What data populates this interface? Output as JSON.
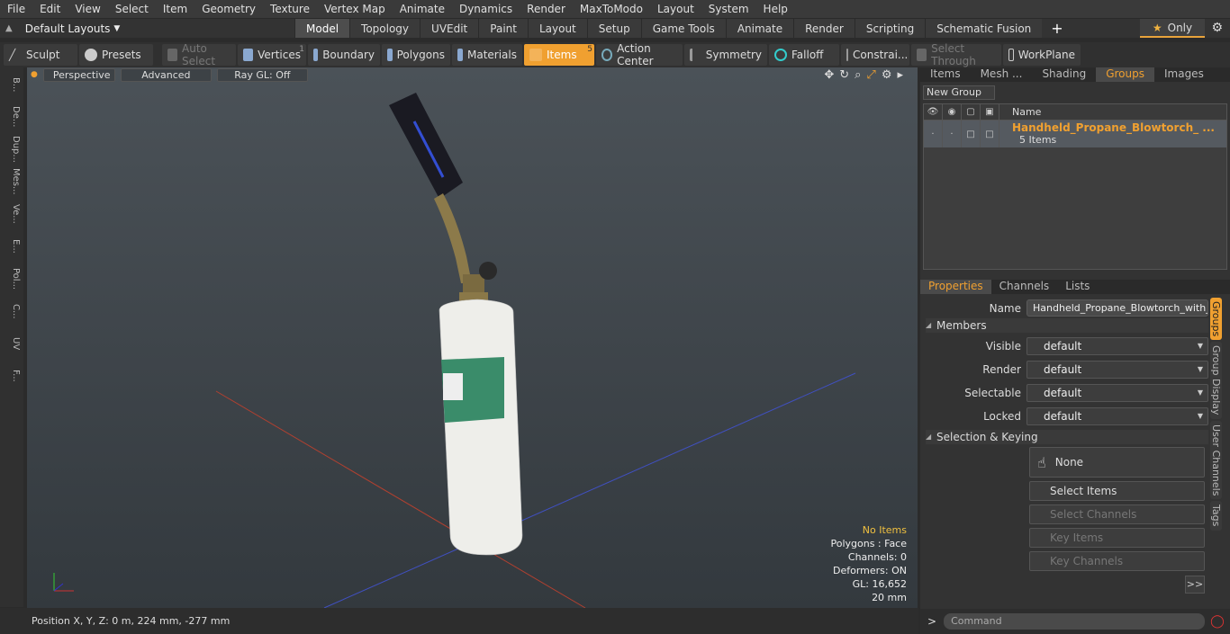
{
  "menu": [
    "File",
    "Edit",
    "View",
    "Select",
    "Item",
    "Geometry",
    "Texture",
    "Vertex Map",
    "Animate",
    "Dynamics",
    "Render",
    "MaxToModo",
    "Layout",
    "System",
    "Help"
  ],
  "layouts": {
    "label": "Default Layouts"
  },
  "modes": [
    "Model",
    "Topology",
    "UVEdit",
    "Paint",
    "Layout",
    "Setup",
    "Game Tools",
    "Animate",
    "Render",
    "Scripting",
    "Schematic Fusion"
  ],
  "only_label": "Only",
  "toolbar": {
    "sculpt": "Sculpt",
    "presets": "Presets",
    "auto_select": "Auto Select",
    "vertices": "Vertices",
    "vertices_count": "1",
    "boundary": "Boundary",
    "polygons": "Polygons",
    "materials": "Materials",
    "items": "Items",
    "items_count": "5",
    "action_center": "Action Center",
    "symmetry": "Symmetry",
    "falloff": "Falloff",
    "constraints": "Constrai...",
    "select_through": "Select Through",
    "workplane": "WorkPlane"
  },
  "left_tabs": [
    "B...",
    "De...",
    "Dup...",
    "Mes...",
    "Ve...",
    "E...",
    "Pol...",
    "C...",
    "UV",
    "F..."
  ],
  "viewport": {
    "perspective": "Perspective",
    "advanced": "Advanced",
    "raygl": "Ray GL: Off",
    "stats": {
      "items": "No Items",
      "polygons": "Polygons : Face",
      "channels": "Channels: 0",
      "deformers": "Deformers: ON",
      "gl": "GL: 16,652",
      "scale": "20 mm"
    }
  },
  "position_readout": "Position X, Y, Z:   0 m, 224 mm, -277 mm",
  "right_tabs": [
    "Items",
    "Mesh ...",
    "Shading",
    "Groups",
    "Images"
  ],
  "new_group": "New Group",
  "grid": {
    "name_header": "Name",
    "group_name": "Handheld_Propane_Blowtorch_ ...",
    "group_count": "5 Items"
  },
  "prop_tabs": [
    "Properties",
    "Channels",
    "Lists"
  ],
  "properties": {
    "name_label": "Name",
    "name_value": "Handheld_Propane_Blowtorch_with_F",
    "members": "Members",
    "visible_label": "Visible",
    "visible_value": "default",
    "render_label": "Render",
    "render_value": "default",
    "selectable_label": "Selectable",
    "selectable_value": "default",
    "locked_label": "Locked",
    "locked_value": "default",
    "selection_keying": "Selection & Keying",
    "none": "None",
    "select_items": "Select Items",
    "select_channels": "Select Channels",
    "key_items": "Key Items",
    "key_channels": "Key Channels",
    "more": ">>"
  },
  "vertical_tabs": [
    "Groups",
    "Group Display",
    "User Channels",
    "Tags"
  ],
  "command_placeholder": "Command"
}
